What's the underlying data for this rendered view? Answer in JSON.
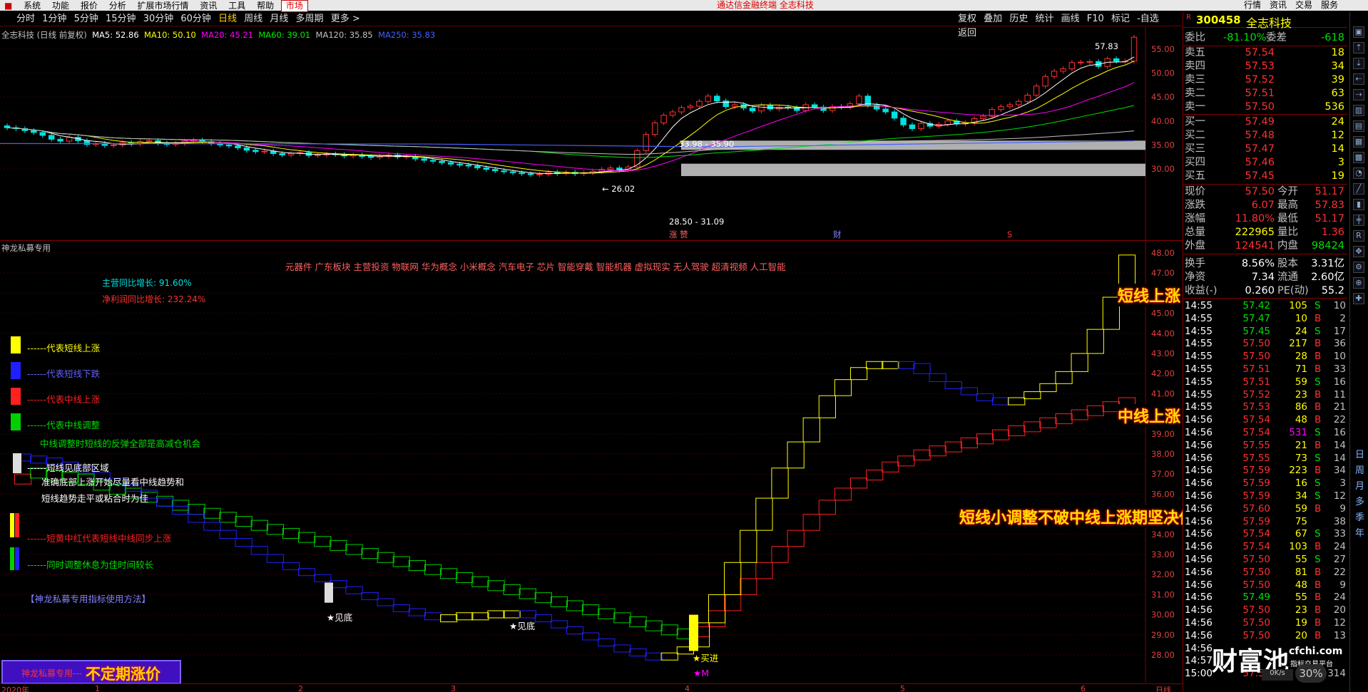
{
  "menubar": {
    "items": [
      "系统",
      "功能",
      "报价",
      "分析",
      "扩展市场行情",
      "资讯",
      "工具",
      "帮助"
    ],
    "active": "市场",
    "title": "通达信金融终端 全志科技",
    "right": [
      "行情",
      "资讯",
      "交易",
      "服务"
    ]
  },
  "toolbar": {
    "periods": [
      "分时",
      "1分钟",
      "5分钟",
      "15分钟",
      "30分钟",
      "60分钟",
      "日线",
      "周线",
      "月线",
      "多周期",
      "更多 >"
    ],
    "selected": "日线",
    "right": [
      "复权",
      "叠加",
      "历史",
      "统计",
      "画线",
      "F10",
      "标记",
      "-自选",
      "返回"
    ]
  },
  "price_panel": {
    "title": "全志科技 (日线 前复权)",
    "ma": [
      {
        "label": "MA5: 52.86",
        "color": "#ffffff"
      },
      {
        "label": "MA10: 50.10",
        "color": "#ffff00"
      },
      {
        "label": "MA20: 45.21",
        "color": "#ff00ff"
      },
      {
        "label": "MA60: 39.01",
        "color": "#00e000"
      },
      {
        "label": "MA120: 35.85",
        "color": "#c0c0c0"
      },
      {
        "label": "MA250: 35.83",
        "color": "#4060ff"
      }
    ],
    "yaxis": [
      "55.00",
      "50.00",
      "45.00",
      "40.00",
      "35.00",
      "30.00"
    ],
    "annotations": {
      "high": "57.83",
      "low": "← 26.02",
      "band1": "33.98 - 35.90",
      "band2": "28.50 - 31.09",
      "marker_zhangting": "涨 赞",
      "marker_cai": "财",
      "marker_s": "S"
    }
  },
  "indicator_panel": {
    "title": "神龙私募专用",
    "yaxis": [
      "48.00",
      "47.00",
      "46.00",
      "45.00",
      "44.00",
      "43.00",
      "42.00",
      "41.00",
      "40.00",
      "39.00",
      "38.00",
      "37.00",
      "36.00",
      "35.00",
      "34.00",
      "33.00",
      "32.00",
      "31.00",
      "30.00",
      "29.00",
      "28.00"
    ],
    "concepts": "元器件 广东板块 主营投资 物联网 华为概念 小米概念 汽车电子 芯片 智能穿戴 智能机器 虚拟现实 无人驾驶 超清视频 人工智能",
    "revenue_growth": "主营同比增长: 91.60%",
    "profit_growth": "净利润同比增长: 232.24%",
    "legend": [
      {
        "text": "------代表短线上涨",
        "color": "#ffff00",
        "swatch": "#ffff00"
      },
      {
        "text": "------代表短线下跌",
        "color": "#6060ff",
        "swatch": "#2020ff"
      },
      {
        "text": "------代表中线上涨",
        "color": "#ff2020",
        "swatch": "#ff2020"
      },
      {
        "text": "------代表中线调整",
        "color": "#00e000",
        "swatch": "#00d000"
      }
    ],
    "note1": "中线调整时短线的反弹全部是高减仓机会",
    "note2": "------短线见底部区域",
    "note3a": "准确底部上涨开始尽量看中线趋势和",
    "note3b": "短线趋势走平或粘合时为佳",
    "note4": "------短黄中红代表短线中线同步上涨",
    "note5": "------同时调整休息为佳时间较长",
    "link": "【神龙私募专用指标使用方法】",
    "bottom_label": "神龙私募专用---",
    "bottom_big": "不定期涨价",
    "markers": {
      "bottom1": "★见底",
      "bottom2": "★见底",
      "buy": "★买进",
      "m": "★M"
    },
    "callouts": {
      "short": "短线上涨",
      "mid": "中线上涨",
      "hold": "短线小调整不破中线上涨期坚决保持"
    }
  },
  "xaxis": [
    "2020年",
    "1",
    "2",
    "3",
    "4",
    "5",
    "6",
    "日线"
  ],
  "quote": {
    "code": "300458",
    "name": "全志科技",
    "weibi_label": "委比",
    "weibi": "-81.10%",
    "weicha_label": "委差",
    "weicha": "-618",
    "sell": [
      {
        "label": "卖五",
        "price": "57.54",
        "vol": "18"
      },
      {
        "label": "卖四",
        "price": "57.53",
        "vol": "34"
      },
      {
        "label": "卖三",
        "price": "57.52",
        "vol": "39"
      },
      {
        "label": "卖二",
        "price": "57.51",
        "vol": "63"
      },
      {
        "label": "卖一",
        "price": "57.50",
        "vol": "536"
      }
    ],
    "buy": [
      {
        "label": "买一",
        "price": "57.49",
        "vol": "24"
      },
      {
        "label": "买二",
        "price": "57.48",
        "vol": "12"
      },
      {
        "label": "买三",
        "price": "57.47",
        "vol": "14"
      },
      {
        "label": "买四",
        "price": "57.46",
        "vol": "3"
      },
      {
        "label": "买五",
        "price": "57.45",
        "vol": "19"
      }
    ],
    "stats": [
      {
        "l1": "现价",
        "v1": "57.50",
        "c1": "#ff3030",
        "l2": "今开",
        "v2": "51.17",
        "c2": "#ff3030"
      },
      {
        "l1": "涨跌",
        "v1": "6.07",
        "c1": "#ff3030",
        "l2": "最高",
        "v2": "57.83",
        "c2": "#ff3030"
      },
      {
        "l1": "涨幅",
        "v1": "11.80%",
        "c1": "#ff3030",
        "l2": "最低",
        "v2": "51.17",
        "c2": "#ff3030"
      },
      {
        "l1": "总量",
        "v1": "222965",
        "c1": "#ffff00",
        "l2": "量比",
        "v2": "1.36",
        "c2": "#ff3030"
      },
      {
        "l1": "外盘",
        "v1": "124541",
        "c1": "#ff3030",
        "l2": "内盘",
        "v2": "98424",
        "c2": "#00e000"
      },
      {
        "l1": "换手",
        "v1": "8.56%",
        "c1": "#ffffff",
        "l2": "股本",
        "v2": "3.31亿",
        "c2": "#ffffff"
      },
      {
        "l1": "净资",
        "v1": "7.34",
        "c1": "#ffffff",
        "l2": "流通",
        "v2": "2.60亿",
        "c2": "#ffffff"
      },
      {
        "l1": "收益(-)",
        "v1": "0.260",
        "c1": "#ffffff",
        "l2": "PE(动)",
        "v2": "55.2",
        "c2": "#ffffff"
      }
    ],
    "ticks": [
      {
        "t": "14:55",
        "p": "57.42",
        "v": "105",
        "s": "S",
        "n": "10"
      },
      {
        "t": "14:55",
        "p": "57.47",
        "v": "10",
        "s": "B",
        "n": "2"
      },
      {
        "t": "14:55",
        "p": "57.45",
        "v": "24",
        "s": "S",
        "n": "17"
      },
      {
        "t": "14:55",
        "p": "57.50",
        "v": "217",
        "s": "B",
        "n": "36"
      },
      {
        "t": "14:55",
        "p": "57.50",
        "v": "28",
        "s": "B",
        "n": "10"
      },
      {
        "t": "14:55",
        "p": "57.51",
        "v": "71",
        "s": "B",
        "n": "33"
      },
      {
        "t": "14:55",
        "p": "57.51",
        "v": "59",
        "s": "S",
        "n": "16"
      },
      {
        "t": "14:55",
        "p": "57.52",
        "v": "23",
        "s": "B",
        "n": "11"
      },
      {
        "t": "14:55",
        "p": "57.53",
        "v": "86",
        "s": "B",
        "n": "21"
      },
      {
        "t": "14:56",
        "p": "57.54",
        "v": "48",
        "s": "B",
        "n": "22"
      },
      {
        "t": "14:56",
        "p": "57.54",
        "v": "531",
        "s": "S",
        "n": "16"
      },
      {
        "t": "14:56",
        "p": "57.55",
        "v": "21",
        "s": "B",
        "n": "14"
      },
      {
        "t": "14:56",
        "p": "57.55",
        "v": "73",
        "s": "S",
        "n": "14"
      },
      {
        "t": "14:56",
        "p": "57.59",
        "v": "223",
        "s": "B",
        "n": "34"
      },
      {
        "t": "14:56",
        "p": "57.59",
        "v": "16",
        "s": "S",
        "n": "3"
      },
      {
        "t": "14:56",
        "p": "57.59",
        "v": "34",
        "s": "S",
        "n": "12"
      },
      {
        "t": "14:56",
        "p": "57.60",
        "v": "59",
        "s": "B",
        "n": "9"
      },
      {
        "t": "14:56",
        "p": "57.59",
        "v": "75",
        "s": "",
        "n": "38"
      },
      {
        "t": "14:56",
        "p": "57.54",
        "v": "67",
        "s": "S",
        "n": "33"
      },
      {
        "t": "14:56",
        "p": "57.54",
        "v": "103",
        "s": "B",
        "n": "24"
      },
      {
        "t": "14:56",
        "p": "57.50",
        "v": "55",
        "s": "S",
        "n": "27"
      },
      {
        "t": "14:56",
        "p": "57.50",
        "v": "81",
        "s": "B",
        "n": "22"
      },
      {
        "t": "14:56",
        "p": "57.50",
        "v": "48",
        "s": "B",
        "n": "9"
      },
      {
        "t": "14:56",
        "p": "57.49",
        "v": "55",
        "s": "B",
        "n": "24"
      },
      {
        "t": "14:56",
        "p": "57.50",
        "v": "23",
        "s": "B",
        "n": "20"
      },
      {
        "t": "14:56",
        "p": "57.50",
        "v": "19",
        "s": "B",
        "n": "12"
      },
      {
        "t": "14:56",
        "p": "57.50",
        "v": "20",
        "s": "B",
        "n": "13"
      },
      {
        "t": "14:56",
        "p": "",
        "v": "",
        "s": "",
        "n": ""
      },
      {
        "t": "14:57",
        "p": "",
        "v": "",
        "s": "",
        "n": ""
      },
      {
        "t": "15:00",
        "p": "57.50",
        "v": "",
        "s": "",
        "n": "314"
      }
    ],
    "watermark": "财富池",
    "watermark_site": "cfchi.com",
    "watermark_sub": "指标交易平台",
    "net": "0K/s",
    "pct": "30%"
  },
  "sidebar": [
    "日",
    "周",
    "月",
    "多",
    "季",
    "年"
  ],
  "colors": {
    "up": "#ff3030",
    "down": "#00e000",
    "short_up": "#ffff00",
    "short_down": "#2020ff",
    "mid_up": "#ff2020",
    "mid_down": "#00d000",
    "grid": "#3a0000",
    "axis": "#ff3030"
  }
}
